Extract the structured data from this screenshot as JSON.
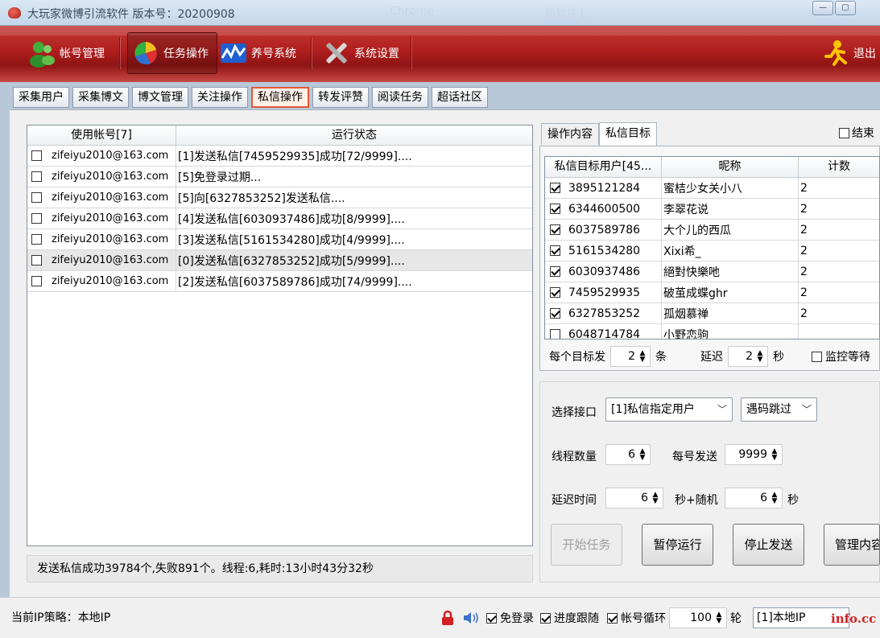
{
  "window": {
    "title": "大玩家微博引流软件  版本号：20200908",
    "ghost_text_1": "Chrome",
    "ghost_text_2": "销软件1"
  },
  "toolbar": {
    "items": [
      {
        "label": "帐号管理",
        "icon": "users-icon"
      },
      {
        "label": "任务操作",
        "icon": "pie-chart-icon",
        "active": true
      },
      {
        "label": "养号系统",
        "icon": "wave-chart-icon"
      },
      {
        "label": "系统设置",
        "icon": "tools-icon"
      }
    ],
    "exit_label": "退出"
  },
  "tabs": [
    "采集用户",
    "采集博文",
    "博文管理",
    "关注操作",
    "私信操作",
    "转发评赞",
    "阅读任务",
    "超话社区"
  ],
  "active_tab": "私信操作",
  "accounts": {
    "header_account": "使用帐号[7]",
    "header_status": "运行状态",
    "rows": [
      {
        "account": "zifeiyu2010@163.com",
        "status": "[1]发送私信[7459529935]成功[72/9999]...."
      },
      {
        "account": "zifeiyu2010@163.com",
        "status": "[5]免登录过期..."
      },
      {
        "account": "zifeiyu2010@163.com",
        "status": "[5]向[6327853252]发送私信...."
      },
      {
        "account": "zifeiyu2010@163.com",
        "status": "[4]发送私信[6030937486]成功[8/9999]...."
      },
      {
        "account": "zifeiyu2010@163.com",
        "status": "[3]发送私信[5161534280]成功[4/9999]...."
      },
      {
        "account": "zifeiyu2010@163.com",
        "status": "[0]发送私信[6327853252]成功[5/9999]...."
      },
      {
        "account": "zifeiyu2010@163.com",
        "status": "[2]发送私信[6037589786]成功[74/9999]...."
      }
    ],
    "summary": "发送私信成功39784个,失败891个。线程:6,耗时:13小时43分32秒"
  },
  "right_panel": {
    "tab_content": "操作内容",
    "tab_targets": "私信目标",
    "end_label": "结束",
    "table_headers": [
      "私信目标用户[45...",
      "昵称",
      "计数"
    ],
    "targets": [
      {
        "id": "3895121284",
        "nick": "蜜桔少女关小八",
        "count": "2",
        "checked": true
      },
      {
        "id": "6344600500",
        "nick": "李翠花说",
        "count": "2",
        "checked": true
      },
      {
        "id": "6037589786",
        "nick": "大个儿的西瓜",
        "count": "2",
        "checked": true
      },
      {
        "id": "5161534280",
        "nick": "Xixi希_",
        "count": "2",
        "checked": true
      },
      {
        "id": "6030937486",
        "nick": "絕對快樂吔",
        "count": "2",
        "checked": true
      },
      {
        "id": "7459529935",
        "nick": "破茧成蝶ghr",
        "count": "2",
        "checked": true
      },
      {
        "id": "6327853252",
        "nick": "孤烟慕禅",
        "count": "2",
        "checked": true
      },
      {
        "id": "6048714784",
        "nick": "小野恋驹",
        "count": "",
        "checked": false
      }
    ],
    "per_target_label": "每个目标发",
    "per_target_value": "2",
    "per_target_unit": "条",
    "delay_label": "延迟",
    "delay_value": "2",
    "delay_unit": "秒",
    "monitor_label": "监控等待"
  },
  "form": {
    "interface_label": "选择接口",
    "interface_value": "[1]私信指定用户",
    "code_value": "遇码跳过",
    "threads_label": "线程数量",
    "threads_value": "6",
    "per_account_label": "每号发送",
    "per_account_value": "9999",
    "delay_label": "延迟时间",
    "delay_value": "6",
    "random_label": "秒+随机",
    "random_value": "6",
    "random_unit": "秒",
    "btn_start": "开始任务",
    "btn_pause": "暂停运行",
    "btn_stop": "停止发送",
    "btn_manage": "管理内容"
  },
  "statusbar": {
    "ip_policy": "当前IP策略：本地IP",
    "lock_icon": "lock-icon",
    "sound_icon": "speaker-icon",
    "no_login_label": "免登录",
    "progress_label": "进度跟随",
    "account_loop_label": "帐号循环",
    "rounds_value": "100",
    "rounds_unit": "轮",
    "ip_select": "[1]本地IP",
    "watermark": "info.cc"
  },
  "colors": {
    "toolbar_red": "#b01e1e",
    "active_tab_border": "#e05a35",
    "lock_red": "#d42020"
  }
}
